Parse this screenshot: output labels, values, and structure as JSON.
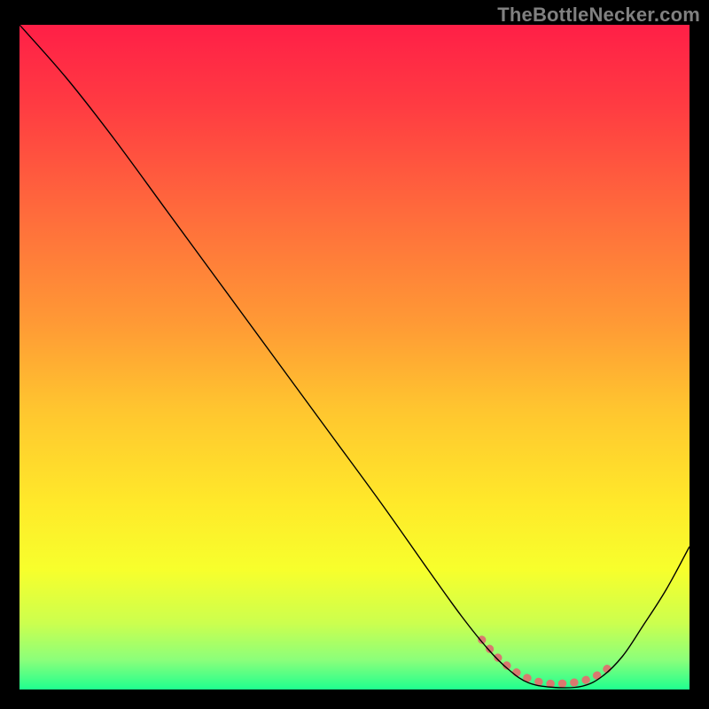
{
  "watermark": "TheBottleNecker.com",
  "chart_data": {
    "type": "line",
    "title": "",
    "xlabel": "",
    "ylabel": "",
    "xlim": [
      0,
      100
    ],
    "ylim": [
      0,
      100
    ],
    "grid": false,
    "background_gradient": {
      "stops": [
        {
          "offset": 0.0,
          "color": "#ff1f47"
        },
        {
          "offset": 0.12,
          "color": "#ff3b42"
        },
        {
          "offset": 0.28,
          "color": "#ff6a3c"
        },
        {
          "offset": 0.45,
          "color": "#ff9a35"
        },
        {
          "offset": 0.58,
          "color": "#ffc62f"
        },
        {
          "offset": 0.72,
          "color": "#ffe92a"
        },
        {
          "offset": 0.82,
          "color": "#f7ff2c"
        },
        {
          "offset": 0.9,
          "color": "#ccff4e"
        },
        {
          "offset": 0.955,
          "color": "#8cff7a"
        },
        {
          "offset": 1.0,
          "color": "#1fff8f"
        }
      ]
    },
    "series": [
      {
        "name": "bottleneck-curve",
        "stroke": "#000000",
        "stroke_width": 1.4,
        "points": [
          {
            "x": 0.0,
            "y": 100.0
          },
          {
            "x": 7.0,
            "y": 92.0
          },
          {
            "x": 14.0,
            "y": 83.0
          },
          {
            "x": 22.0,
            "y": 72.0
          },
          {
            "x": 30.0,
            "y": 61.0
          },
          {
            "x": 38.0,
            "y": 50.0
          },
          {
            "x": 46.0,
            "y": 39.0
          },
          {
            "x": 54.0,
            "y": 28.0
          },
          {
            "x": 61.0,
            "y": 18.0
          },
          {
            "x": 66.0,
            "y": 11.0
          },
          {
            "x": 70.0,
            "y": 6.0
          },
          {
            "x": 73.0,
            "y": 3.0
          },
          {
            "x": 76.0,
            "y": 1.0
          },
          {
            "x": 80.0,
            "y": 0.3
          },
          {
            "x": 84.0,
            "y": 0.5
          },
          {
            "x": 87.0,
            "y": 2.0
          },
          {
            "x": 90.0,
            "y": 5.0
          },
          {
            "x": 93.0,
            "y": 9.5
          },
          {
            "x": 96.5,
            "y": 15.0
          },
          {
            "x": 100.0,
            "y": 21.5
          }
        ]
      },
      {
        "name": "optimal-zone-marker",
        "stroke": "#d9796f",
        "stroke_width": 9,
        "linecap": "round",
        "points": [
          {
            "x": 69.0,
            "y": 7.5
          },
          {
            "x": 71.0,
            "y": 5.2
          },
          {
            "x": 73.0,
            "y": 3.4
          },
          {
            "x": 75.0,
            "y": 2.1
          },
          {
            "x": 77.0,
            "y": 1.3
          },
          {
            "x": 79.0,
            "y": 0.9
          },
          {
            "x": 81.0,
            "y": 0.9
          },
          {
            "x": 83.0,
            "y": 1.1
          },
          {
            "x": 85.0,
            "y": 1.6
          },
          {
            "x": 87.0,
            "y": 2.6
          },
          {
            "x": 89.0,
            "y": 4.2
          }
        ]
      }
    ]
  }
}
